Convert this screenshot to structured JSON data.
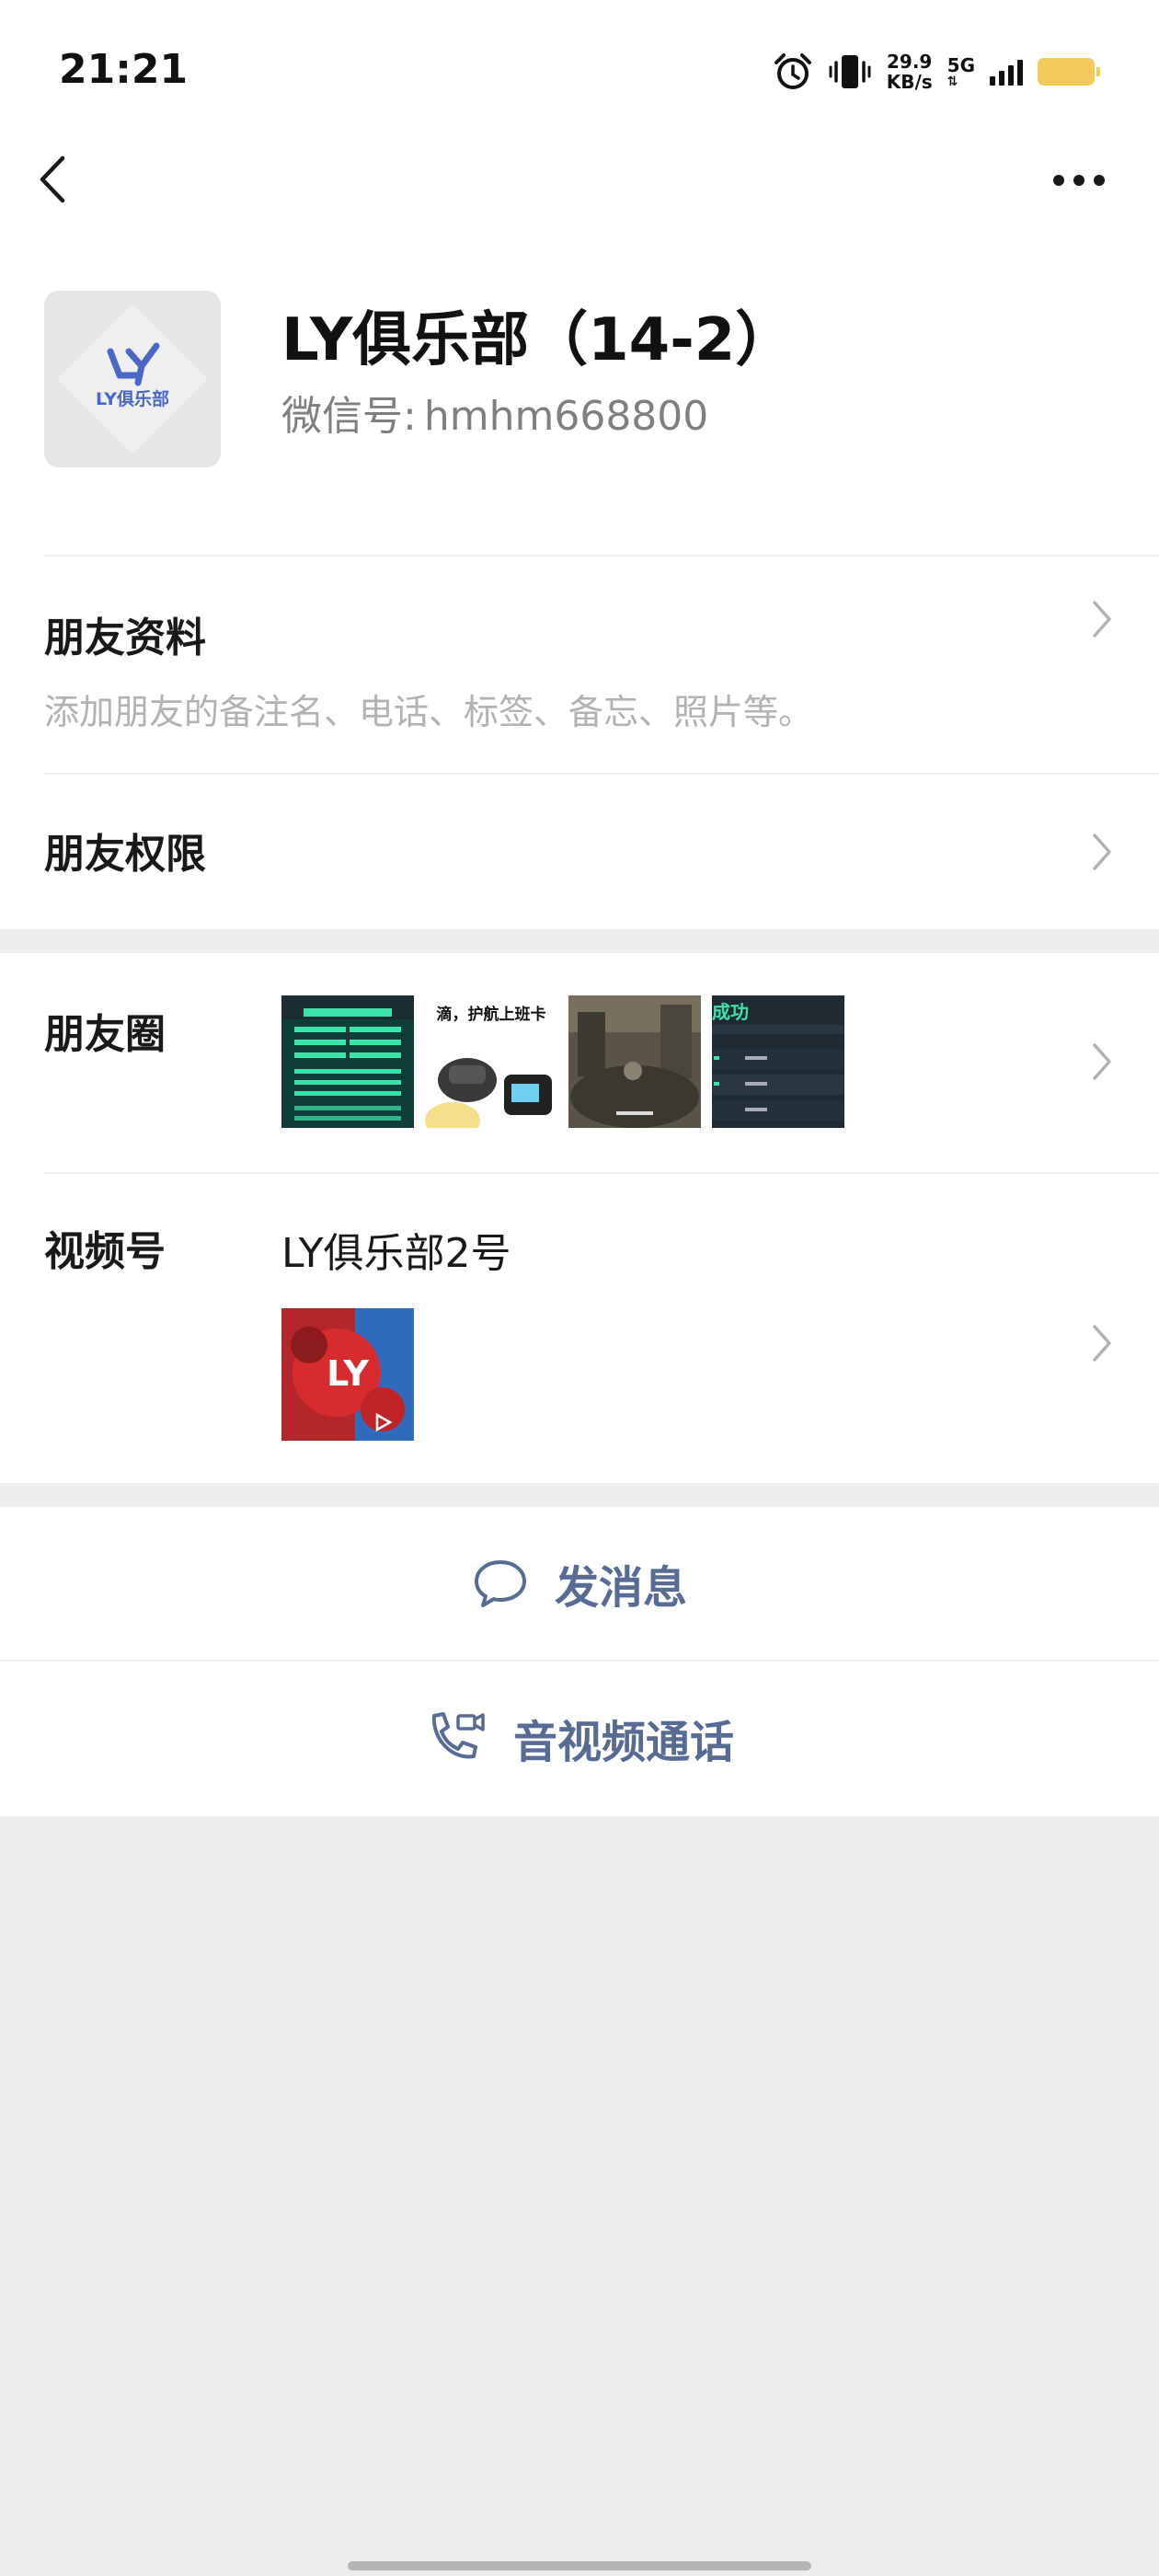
{
  "status_bar": {
    "time": "21:21",
    "net_speed_value": "29.9",
    "net_speed_unit": "KB/s",
    "network": "5G",
    "icons": [
      "alarm-icon",
      "vibrate-icon",
      "signal-icon",
      "battery-icon"
    ]
  },
  "nav": {
    "back_icon": "chevron-left-icon",
    "more_icon": "more-dots-icon"
  },
  "profile": {
    "avatar_text": "LY俱乐部",
    "name": "LY俱乐部（14-2）",
    "wechat_id_label": "微信号:",
    "wechat_id": "hmhm668800"
  },
  "friend_info": {
    "title": "朋友资料",
    "subtitle": "添加朋友的备注名、电话、标签、备忘、照片等。"
  },
  "friend_permissions": {
    "title": "朋友权限"
  },
  "moments": {
    "title": "朋友圈",
    "thumbs": [
      {
        "caption": ""
      },
      {
        "caption": "滴，护航上班卡"
      },
      {
        "caption": ""
      },
      {
        "caption": "成功"
      }
    ]
  },
  "channels": {
    "title": "视频号",
    "channel_name": "LY俱乐部2号",
    "thumb_text": "LY"
  },
  "actions": {
    "send_message": "发消息",
    "av_call": "音视频通话"
  },
  "colors": {
    "link_blue": "#576b95",
    "background": "#ededed",
    "secondary_text": "#7f7f7f"
  }
}
